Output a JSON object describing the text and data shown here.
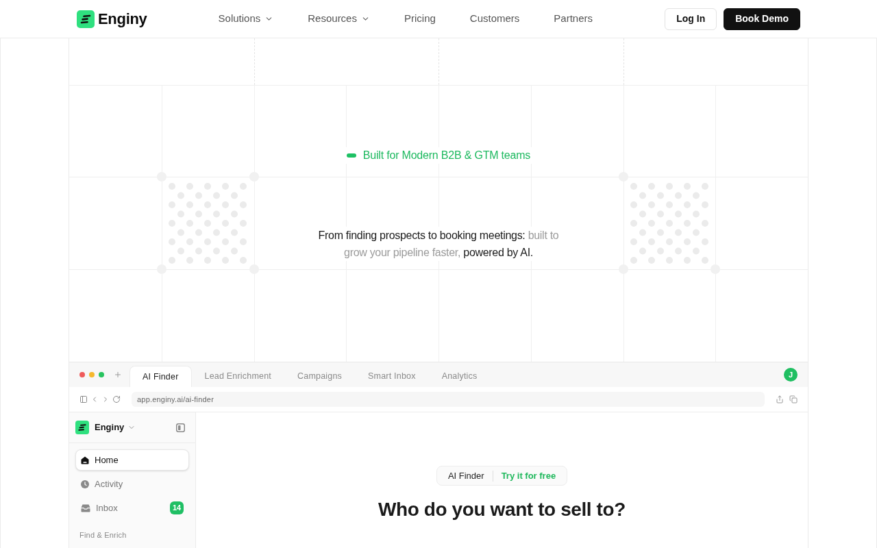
{
  "header": {
    "logo": "Enginy",
    "nav": [
      {
        "label": "Solutions",
        "has_menu": true
      },
      {
        "label": "Resources",
        "has_menu": true
      },
      {
        "label": "Pricing",
        "has_menu": false
      },
      {
        "label": "Customers",
        "has_menu": false
      },
      {
        "label": "Partners",
        "has_menu": false
      }
    ],
    "buttons": [
      {
        "label": "Log In",
        "kind": "outline"
      },
      {
        "label": "Book Demo",
        "kind": "solid"
      }
    ]
  },
  "hero": {
    "tagline": "Built for Modern B2B & GTM teams",
    "description": [
      {
        "text": "From finding prospects to booking meetings:",
        "muted": false
      },
      {
        "text": "built to grow your pipeline faster,",
        "muted": true
      },
      {
        "text": "powered by AI.",
        "muted": false
      }
    ]
  },
  "browser": {
    "tabs": [
      {
        "label": "AI Finder",
        "selected": true
      },
      {
        "label": "Lead Enrichment",
        "selected": false
      },
      {
        "label": "Campaigns",
        "selected": false
      },
      {
        "label": "Smart Inbox",
        "selected": false
      },
      {
        "label": "Analytics",
        "selected": false
      }
    ],
    "avatar": "J",
    "url": "app.enginy.ai/ai-finder"
  },
  "app": {
    "workspace": "Enginy",
    "sidebar": {
      "items": [
        {
          "label": "Home",
          "selected": true
        },
        {
          "label": "Activity",
          "selected": false
        },
        {
          "label": "Inbox",
          "selected": false,
          "badge": "14"
        }
      ],
      "section": "Find & Enrich"
    },
    "main": {
      "pill": {
        "label": "AI Finder",
        "action": "Try it for free"
      },
      "heading": "Who do you want to sell to?"
    }
  }
}
